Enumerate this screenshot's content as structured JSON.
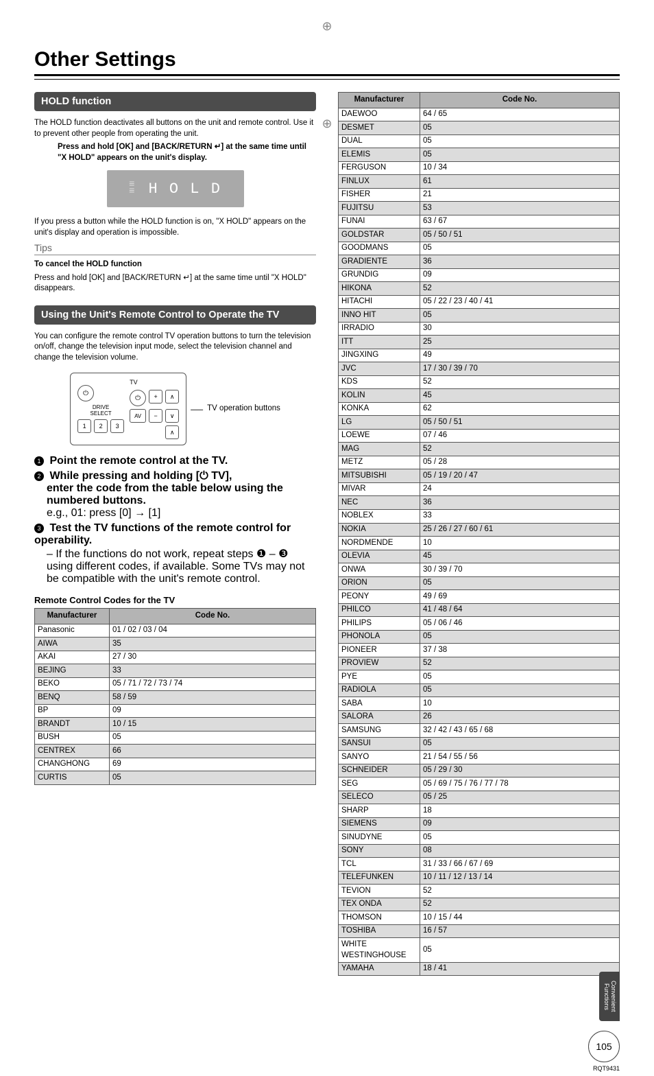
{
  "title": "Other Settings",
  "hold": {
    "bar": "HOLD function",
    "intro": "The HOLD function deactivates all buttons on the unit and remote control. Use it to prevent other people from operating the unit.",
    "instruction": "Press and hold [OK] and [BACK/RETURN ↵] at the same time until \"X HOLD\" appears on the unit's display.",
    "display_text": "H O L D",
    "after": "If you press a button while the HOLD function is on, \"X HOLD\" appears on the unit's display and operation is impossible.",
    "tips_label": "Tips",
    "tips_title": "To cancel the HOLD function",
    "tips_body": "Press and hold [OK] and [BACK/RETURN ↵] at the same time until \"X HOLD\" disappears."
  },
  "remote": {
    "bar": "Using the Unit's Remote Control to Operate the TV",
    "intro": "You can configure the remote control TV operation buttons to turn the television on/off, change the television input mode, select the television channel and change the television volume.",
    "caption": "TV operation buttons",
    "step1": "Point the remote control at the TV.",
    "step2a": "While pressing and holding [⏻ TV],",
    "step2b": "enter the code from the table below using the numbered buttons.",
    "step_eg": "e.g., 01: press [0] → [1]",
    "step3": "Test the TV functions of the remote control for operability.",
    "step3_sub": "– If the functions do not work, repeat steps ❶ – ❸ using different codes, if available. Some TVs may not be compatible with the unit's remote control.",
    "codes_title": "Remote Control Codes for the TV",
    "th_manufacturer": "Manufacturer",
    "th_code": "Code No."
  },
  "codes_left": [
    {
      "m": "Panasonic",
      "c": "01 / 02 / 03 / 04"
    },
    {
      "m": "AIWA",
      "c": "35"
    },
    {
      "m": "AKAI",
      "c": "27 / 30"
    },
    {
      "m": "BEJING",
      "c": "33"
    },
    {
      "m": "BEKO",
      "c": "05 / 71 / 72 / 73 / 74"
    },
    {
      "m": "BENQ",
      "c": "58 / 59"
    },
    {
      "m": "BP",
      "c": "09"
    },
    {
      "m": "BRANDT",
      "c": "10 / 15"
    },
    {
      "m": "BUSH",
      "c": "05"
    },
    {
      "m": "CENTREX",
      "c": "66"
    },
    {
      "m": "CHANGHONG",
      "c": "69"
    },
    {
      "m": "CURTIS",
      "c": "05"
    }
  ],
  "codes_right": [
    {
      "m": "DAEWOO",
      "c": "64 / 65"
    },
    {
      "m": "DESMET",
      "c": "05"
    },
    {
      "m": "DUAL",
      "c": "05"
    },
    {
      "m": "ELEMIS",
      "c": "05"
    },
    {
      "m": "FERGUSON",
      "c": "10 / 34"
    },
    {
      "m": "FINLUX",
      "c": "61"
    },
    {
      "m": "FISHER",
      "c": "21"
    },
    {
      "m": "FUJITSU",
      "c": "53"
    },
    {
      "m": "FUNAI",
      "c": "63 / 67"
    },
    {
      "m": "GOLDSTAR",
      "c": "05 / 50 / 51"
    },
    {
      "m": "GOODMANS",
      "c": "05"
    },
    {
      "m": "GRADIENTE",
      "c": "36"
    },
    {
      "m": "GRUNDIG",
      "c": "09"
    },
    {
      "m": "HIKONA",
      "c": "52"
    },
    {
      "m": "HITACHI",
      "c": "05 / 22 / 23 / 40 / 41"
    },
    {
      "m": "INNO HIT",
      "c": "05"
    },
    {
      "m": "IRRADIO",
      "c": "30"
    },
    {
      "m": "ITT",
      "c": "25"
    },
    {
      "m": "JINGXING",
      "c": "49"
    },
    {
      "m": "JVC",
      "c": "17 / 30 / 39 / 70"
    },
    {
      "m": "KDS",
      "c": "52"
    },
    {
      "m": "KOLIN",
      "c": "45"
    },
    {
      "m": "KONKA",
      "c": "62"
    },
    {
      "m": "LG",
      "c": "05 / 50 / 51"
    },
    {
      "m": "LOEWE",
      "c": "07 / 46"
    },
    {
      "m": "MAG",
      "c": "52"
    },
    {
      "m": "METZ",
      "c": "05 / 28"
    },
    {
      "m": "MITSUBISHI",
      "c": "05 / 19 / 20 / 47"
    },
    {
      "m": "MIVAR",
      "c": "24"
    },
    {
      "m": "NEC",
      "c": "36"
    },
    {
      "m": "NOBLEX",
      "c": "33"
    },
    {
      "m": "NOKIA",
      "c": "25 / 26 / 27 / 60 / 61"
    },
    {
      "m": "NORDMENDE",
      "c": "10"
    },
    {
      "m": "OLEVIA",
      "c": "45"
    },
    {
      "m": "ONWA",
      "c": "30 / 39 / 70"
    },
    {
      "m": "ORION",
      "c": "05"
    },
    {
      "m": "PEONY",
      "c": "49 / 69"
    },
    {
      "m": "PHILCO",
      "c": "41 / 48 / 64"
    },
    {
      "m": "PHILIPS",
      "c": "05 / 06 / 46"
    },
    {
      "m": "PHONOLA",
      "c": "05"
    },
    {
      "m": "PIONEER",
      "c": "37 / 38"
    },
    {
      "m": "PROVIEW",
      "c": "52"
    },
    {
      "m": "PYE",
      "c": "05"
    },
    {
      "m": "RADIOLA",
      "c": "05"
    },
    {
      "m": "SABA",
      "c": "10"
    },
    {
      "m": "SALORA",
      "c": "26"
    },
    {
      "m": "SAMSUNG",
      "c": "32 / 42 / 43 / 65 / 68"
    },
    {
      "m": "SANSUI",
      "c": "05"
    },
    {
      "m": "SANYO",
      "c": "21 / 54 / 55 / 56"
    },
    {
      "m": "SCHNEIDER",
      "c": "05 / 29 / 30"
    },
    {
      "m": "SEG",
      "c": "05 / 69 / 75 / 76 / 77 / 78"
    },
    {
      "m": "SELECO",
      "c": "05 / 25"
    },
    {
      "m": "SHARP",
      "c": "18"
    },
    {
      "m": "SIEMENS",
      "c": "09"
    },
    {
      "m": "SINUDYNE",
      "c": "05"
    },
    {
      "m": "SONY",
      "c": "08"
    },
    {
      "m": "TCL",
      "c": "31 / 33 / 66 / 67 / 69"
    },
    {
      "m": "TELEFUNKEN",
      "c": "10 / 11 / 12 / 13 / 14"
    },
    {
      "m": "TEVION",
      "c": "52"
    },
    {
      "m": "TEX ONDA",
      "c": "52"
    },
    {
      "m": "THOMSON",
      "c": "10 / 15 / 44"
    },
    {
      "m": "TOSHIBA",
      "c": "16 / 57"
    },
    {
      "m": "WHITE WESTINGHOUSE",
      "c": "05"
    },
    {
      "m": "YAMAHA",
      "c": "18 / 41"
    }
  ],
  "footer": {
    "side_tab": "Convenient Functions",
    "page_num": "105",
    "rqt": "RQT9431"
  }
}
